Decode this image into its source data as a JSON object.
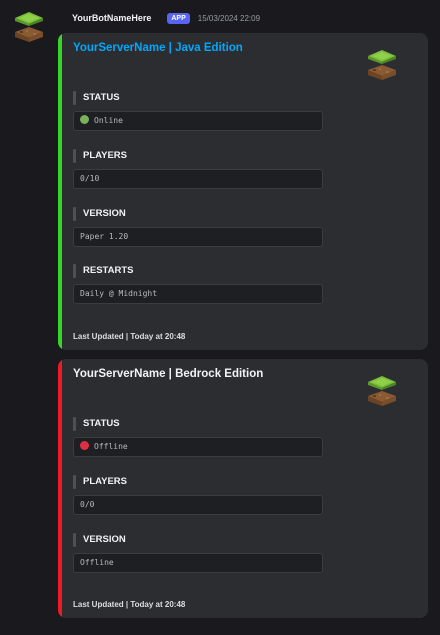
{
  "message": {
    "bot_name": "YourBotNameHere",
    "app_badge": "APP",
    "timestamp": "15/03/2024 22:09",
    "avatar_icon": "minecraft-grass-block-icon"
  },
  "embeds": [
    {
      "title": "YourServerName | Java Edition",
      "accent_color": "#35d628",
      "title_color": "#00a8fc",
      "thumbnail_icon": "minecraft-grass-block-icon",
      "fields": [
        {
          "label": "STATUS",
          "value": "Online",
          "status_icon": "green-circle-icon",
          "status_color": "#78b159"
        },
        {
          "label": "PLAYERS",
          "value": "0/10"
        },
        {
          "label": "VERSION",
          "value": "Paper 1.20"
        },
        {
          "label": "RESTARTS",
          "value": "Daily @ Midnight"
        }
      ],
      "footer": "Last Updated | Today at 20:48"
    },
    {
      "title": "YourServerName | Bedrock Edition",
      "accent_color": "#ed1c24",
      "title_color": "#f2f3f5",
      "thumbnail_icon": "minecraft-grass-block-icon",
      "fields": [
        {
          "label": "STATUS",
          "value": "Offline",
          "status_icon": "red-circle-icon",
          "status_color": "#dd2e44"
        },
        {
          "label": "PLAYERS",
          "value": "0/0"
        },
        {
          "label": "VERSION",
          "value": "Offline"
        }
      ],
      "footer": "Last Updated | Today at 20:48"
    }
  ]
}
